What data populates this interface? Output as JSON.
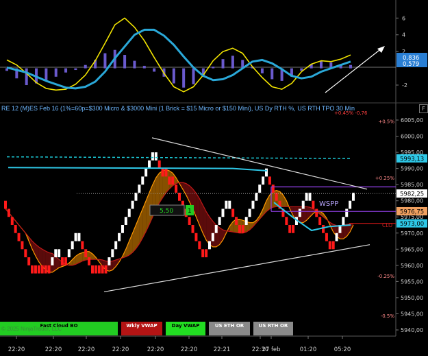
{
  "title_bar": "RE 12 (M)ES Feb 16 (1%=60p=$300 Micro & $3000 Mini  (1 Brick = $15 Micro or $150 Mini), US Dy RTH %, US RTH TPO 30 Min",
  "chart_settings_button": "F",
  "copyright": "© 2025 NinjaTrader, LLC",
  "colors": {
    "background": "#000000",
    "bull_brick": "#ffffff",
    "bear_brick": "#ff1a1a",
    "cloud_bull": "#b36b00",
    "cloud_bear": "#7a0f0f",
    "vwap_line": "#2ec7e6",
    "macd_fast": "#f2e400",
    "macd_slow": "#2aa8d8",
    "histogram": "#6a5acd"
  },
  "buttons": [
    {
      "label": "Fast Cloud BO",
      "color": "#22cc22"
    },
    {
      "label": "Wkly VWAP",
      "color": "#b31414"
    },
    {
      "label": "Day VWAP",
      "color": "#22dd22"
    },
    {
      "label": "US ETH OR",
      "color": "#8a8a8a"
    },
    {
      "label": "US RTH OR",
      "color": "#8a8a8a"
    }
  ],
  "chart_data": [
    {
      "type": "line",
      "panel": "oscillator",
      "y_ticks": [
        "6",
        "4",
        "2",
        "-2"
      ],
      "ylim": [
        -3.8,
        7.5
      ],
      "zero_line": 0,
      "series": [
        {
          "values": [
            1.0,
            0.4,
            -0.6,
            -1.7,
            -2.4,
            -2.6,
            -2.5,
            -1.9,
            -0.8,
            0.9,
            3.0,
            5.2,
            6.0,
            4.9,
            3.3,
            1.3,
            -0.6,
            -2.2,
            -2.8,
            -2.2,
            -0.8,
            0.9,
            2.0,
            2.4,
            1.8,
            0.2,
            -1.1,
            -2.2,
            -2.5,
            -1.8,
            -0.4,
            0.5,
            0.9,
            0.8,
            1.1,
            1.6
          ]
        },
        {
          "values": [
            0.1,
            -0.2,
            -0.5,
            -1.0,
            -1.5,
            -1.9,
            -2.3,
            -2.4,
            -2.2,
            -1.6,
            -0.4,
            1.2,
            2.6,
            4.0,
            4.6,
            4.6,
            3.9,
            2.8,
            1.4,
            0.1,
            -0.9,
            -1.4,
            -1.3,
            -0.8,
            0.0,
            0.8,
            1.0,
            0.6,
            -0.1,
            -0.9,
            -1.2,
            -1.0,
            -0.4,
            0.0,
            0.4,
            0.8
          ]
        }
      ],
      "histogram": [
        -0.3,
        -1.2,
        -2.0,
        -1.8,
        -1.4,
        -1.0,
        -0.5,
        -0.2,
        0.4,
        1.0,
        1.8,
        2.2,
        1.6,
        0.9,
        0.3,
        -0.4,
        -1.0,
        -1.8,
        -2.3,
        -1.9,
        -1.0,
        0.2,
        1.1,
        1.5,
        1.0,
        0.2,
        -0.6,
        -1.3,
        -1.5,
        -1.0,
        -0.3,
        0.5,
        0.9,
        0.7,
        0.5,
        0.4
      ],
      "labels": [
        {
          "text": "0,836",
          "color": "#2a7fd4"
        },
        {
          "text": "0,579",
          "color": "#2a7fd4"
        }
      ]
    },
    {
      "type": "renko",
      "panel": "price",
      "ylim": [
        5938,
        6008
      ],
      "y_ticks": [
        "6005,00",
        "6000,00",
        "5995,00",
        "5990,00",
        "5985,00",
        "5980,00",
        "5975,00",
        "5970,00",
        "5965,00",
        "5960,00",
        "5955,00",
        "5950,00",
        "5945,00",
        "5940,00"
      ],
      "x_ticks": [
        "22:20",
        "22:20",
        "22:20",
        "22:20",
        "22:20",
        "22:20",
        "22:21",
        "22:30",
        "27 feb",
        "01:20",
        "05:20"
      ],
      "bricks": [
        5977.5,
        5975,
        5972.5,
        5970,
        5967.5,
        5965,
        5962.5,
        5960,
        5957.5,
        5957.5,
        5957.5,
        5957.5,
        5957.5,
        5957.5,
        5960,
        5962.5,
        5962.5,
        5960,
        5960,
        5962.5,
        5965,
        5967.5,
        5967.5,
        5965,
        5962.5,
        5960,
        5957.5,
        5957.5,
        5957.5,
        5957.5,
        5957.5,
        5960,
        5962.5,
        5965,
        5967.5,
        5970,
        5972.5,
        5975,
        5977.5,
        5980,
        5982.5,
        5985,
        5987.5,
        5990,
        5992.5,
        5992.5,
        5990,
        5987.5,
        5987.5,
        5985,
        5985,
        5982.5,
        5980,
        5977.5,
        5975,
        5972.5,
        5970,
        5967.5,
        5965,
        5962.5,
        5962.5,
        5965,
        5967.5,
        5970,
        5972.5,
        5975,
        5977.5,
        5977.5,
        5975,
        5972.5,
        5970,
        5970,
        5972.5,
        5975,
        5977.5,
        5980,
        5982.5,
        5985,
        5987.5,
        5985,
        5982.5,
        5980,
        5977.5,
        5975,
        5972.5,
        5970,
        5970,
        5972.5,
        5975,
        5977.5,
        5980,
        5980,
        5977.5,
        5975,
        5972.5,
        5970,
        5967.5,
        5965,
        5965,
        5967.5,
        5970,
        5972.5,
        5975,
        5977.5,
        5980
      ],
      "price_labels": [
        {
          "text": "6005,00",
          "kind": "tick"
        },
        {
          "text": "5993,13",
          "color": "#2ec7e6"
        },
        {
          "text": "5982,25",
          "color": "#ffffff"
        },
        {
          "text": "5976,75",
          "color": "#f0a060"
        },
        {
          "text": "5973,00",
          "color": "#2ec7e6"
        }
      ],
      "pct_labels": [
        "+0.5%",
        "+0.25%",
        "-0.25%",
        "-0.5%"
      ],
      "annotations": [
        "5,50",
        "1",
        "WSPP",
        "CLO",
        "+0,45% -0,76"
      ]
    }
  ]
}
